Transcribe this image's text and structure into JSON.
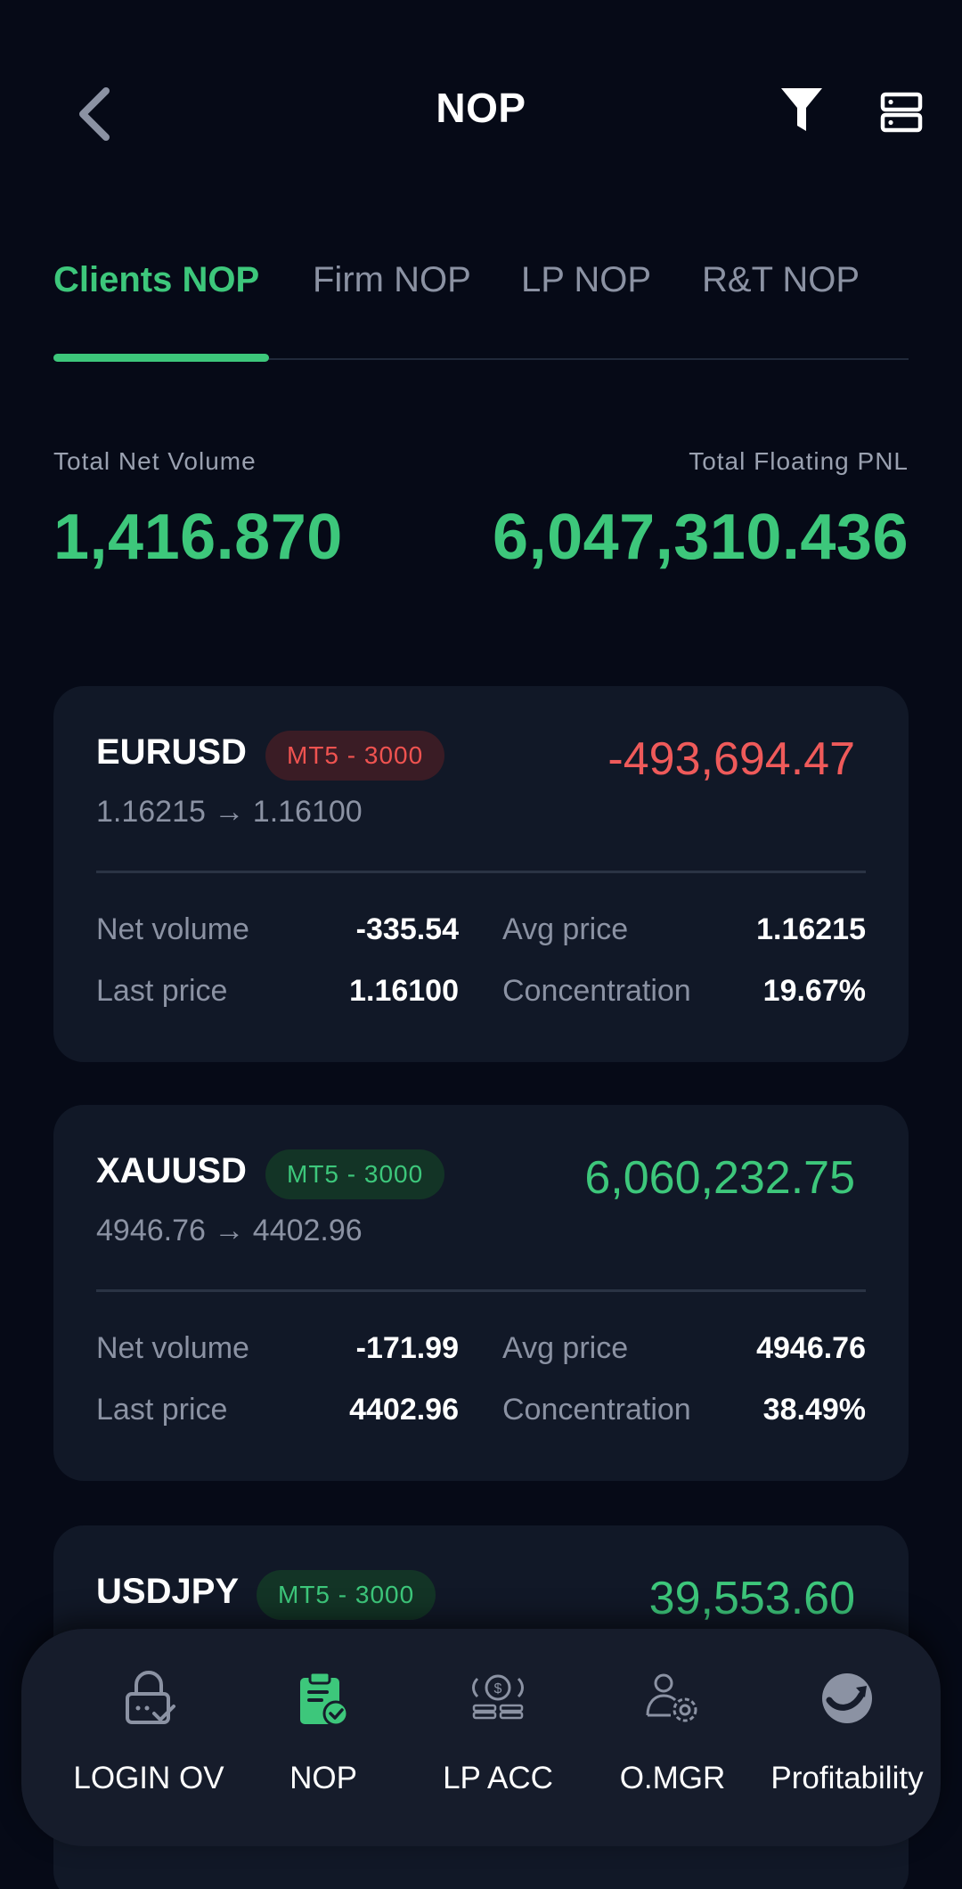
{
  "header": {
    "title": "NOP"
  },
  "tabs": [
    {
      "label": "Clients NOP",
      "active": true
    },
    {
      "label": "Firm NOP",
      "active": false
    },
    {
      "label": "LP NOP",
      "active": false
    },
    {
      "label": "R&T NOP",
      "active": false
    }
  ],
  "totals": {
    "net_volume_label": "Total Net Volume",
    "net_volume_value": "1,416.870",
    "floating_pnl_label": "Total Floating PNL",
    "floating_pnl_value": "6,047,310.436"
  },
  "positions": [
    {
      "symbol": "EURUSD",
      "badge": "MT5 - 3000",
      "pnl": "-493,694.47",
      "route": "1.16215 → 1.16100",
      "net_volume_label": "Net volume",
      "net_volume": "-335.54",
      "avg_price_label": "Avg price",
      "avg_price": "1.16215",
      "last_price_label": "Last price",
      "last_price": "1.16100",
      "concentration_label": "Concentration",
      "concentration": "19.67%"
    },
    {
      "symbol": "XAUUSD",
      "badge": "MT5 - 3000",
      "pnl": "6,060,232.75",
      "route": "4946.76 → 4402.96",
      "net_volume_label": "Net volume",
      "net_volume": "-171.99",
      "avg_price_label": "Avg price",
      "avg_price": "4946.76",
      "last_price_label": "Last price",
      "last_price": "4402.96",
      "concentration_label": "Concentration",
      "concentration": "38.49%"
    },
    {
      "symbol": "USDJPY",
      "badge": "MT5 - 3000",
      "pnl": "39,553.60"
    }
  ],
  "bottom_nav": [
    {
      "label": "LOGIN OV",
      "icon": "lock-check-icon"
    },
    {
      "label": "NOP",
      "icon": "clipboard-check-icon",
      "active": true
    },
    {
      "label": "LP ACC",
      "icon": "coin-stack-icon"
    },
    {
      "label": "O.MGR",
      "icon": "user-gear-icon"
    },
    {
      "label": "Profitability",
      "icon": "profit-globe-icon"
    }
  ],
  "colors": {
    "background": "#060a17",
    "card": "#111827",
    "accent_green": "#3dc77b",
    "negative_red": "#ef5a5a",
    "muted_text": "#8b92a3",
    "nav_background": "#161c2b"
  }
}
